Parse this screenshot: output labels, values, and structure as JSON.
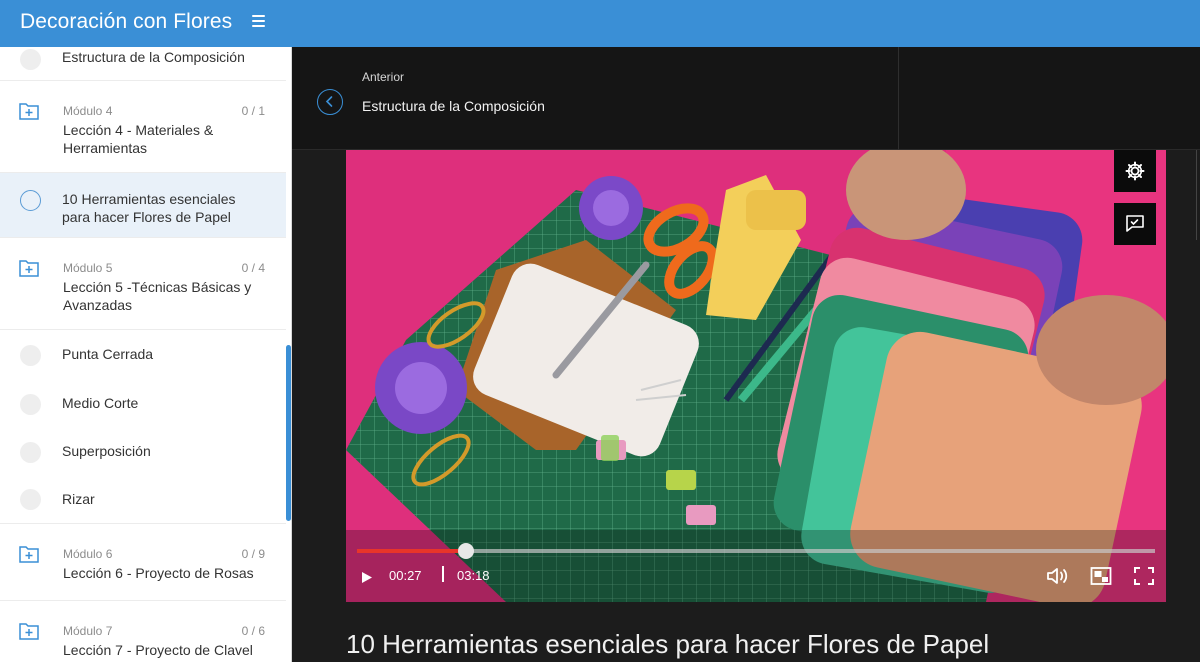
{
  "header": {
    "app_title": "Decoración con Flores",
    "menu_icon": "hamburger-icon"
  },
  "sidebar": {
    "items": [
      {
        "type": "lesson",
        "label": "Estructura de la Composición",
        "state": "incomplete"
      },
      {
        "type": "module",
        "name": "Módulo 4",
        "count": "0 / 1",
        "title": "Lección 4 - Materiales & Herramientas",
        "icon": "folder-plus-icon"
      },
      {
        "type": "lesson",
        "label": "10 Herramientas esenciales para hacer Flores de Papel",
        "state": "current"
      },
      {
        "type": "module",
        "name": "Módulo 5",
        "count": "0 / 4",
        "title": "Lección 5 -Técnicas Básicas y Avanzadas",
        "icon": "folder-plus-icon"
      },
      {
        "type": "lesson",
        "label": "Punta Cerrada",
        "state": "incomplete"
      },
      {
        "type": "lesson",
        "label": "Medio Corte",
        "state": "incomplete"
      },
      {
        "type": "lesson",
        "label": "Superposición",
        "state": "incomplete"
      },
      {
        "type": "lesson",
        "label": "Rizar",
        "state": "incomplete"
      },
      {
        "type": "module",
        "name": "Módulo 6",
        "count": "0 / 9",
        "title": "Lección 6 - Proyecto de Rosas",
        "icon": "folder-plus-icon"
      },
      {
        "type": "module",
        "name": "Módulo 7",
        "count": "0 / 6",
        "title": "Lección 7 - Proyecto de Clavel",
        "icon": "folder-plus-icon"
      }
    ]
  },
  "previous": {
    "label": "Anterior",
    "title": "Estructura de la Composición"
  },
  "player": {
    "current_time": "00:27",
    "duration": "03:18",
    "progress_fraction": 0.136,
    "buttons": [
      "settings-icon",
      "feedback-icon",
      "play-icon",
      "volume-icon",
      "picture-in-picture-icon",
      "fullscreen-icon"
    ]
  },
  "lesson": {
    "title": "10 Herramientas esenciales para hacer Flores de Papel"
  },
  "colors": {
    "brand": "#3a8fd6",
    "progress": "#e8352a",
    "dark_bg": "#1c1c1c"
  }
}
